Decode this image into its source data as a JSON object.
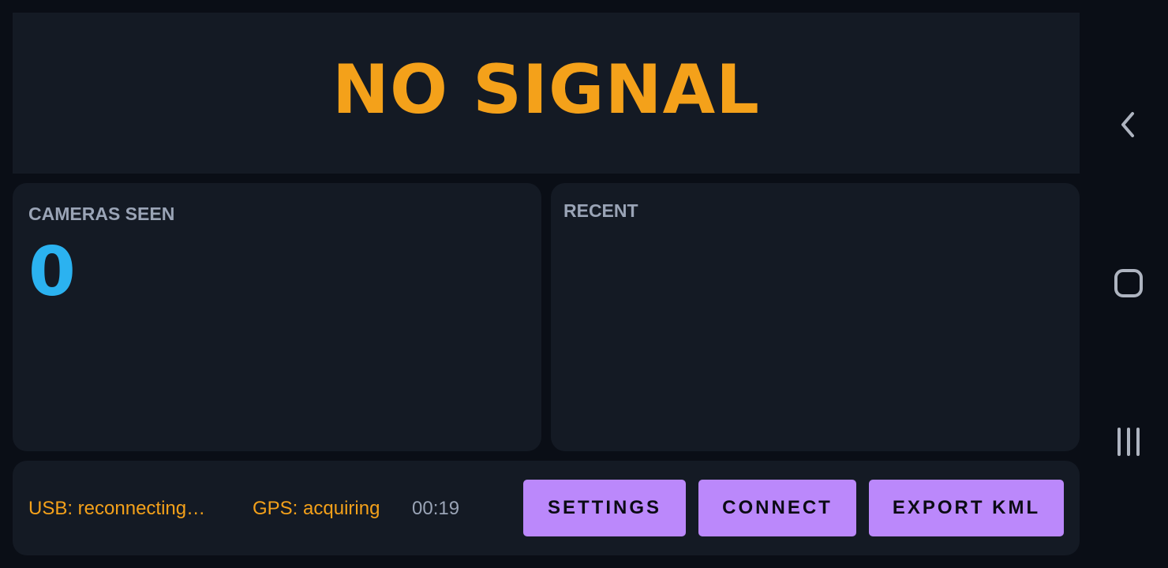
{
  "banner": {
    "status_text": "NO SIGNAL",
    "color": "#f4a11a"
  },
  "cameras_card": {
    "label": "CAMERAS SEEN",
    "count": "0",
    "count_color": "#2bb2f0"
  },
  "recent_card": {
    "label": "RECENT",
    "items": []
  },
  "status_bar": {
    "usb_status": "USB: reconnecting…",
    "gps_status": "GPS: acquiring",
    "elapsed_time": "00:19"
  },
  "actions": {
    "settings_label": "SETTINGS",
    "connect_label": "CONNECT",
    "export_label": "EXPORT KML",
    "button_color": "#bb88fb"
  },
  "system_nav": {
    "back_icon": "back-chevron-icon",
    "home_icon": "home-rounded-square-icon",
    "recents_icon": "recents-bars-icon"
  }
}
